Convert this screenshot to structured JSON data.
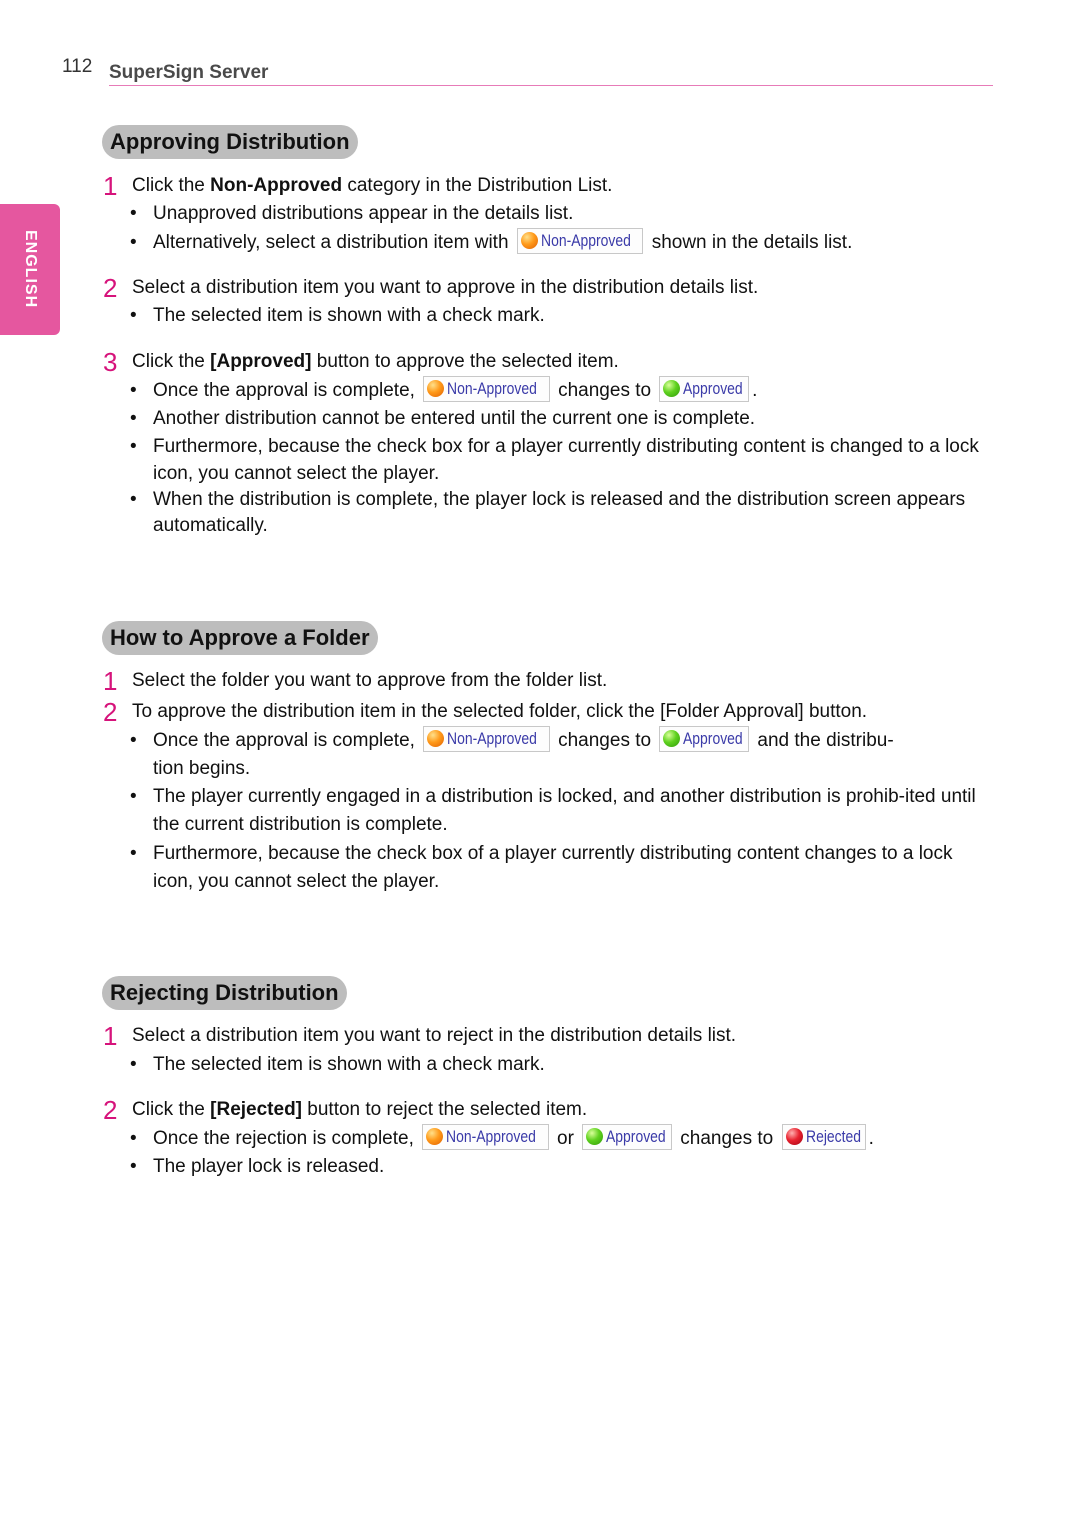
{
  "header": {
    "page_number": "112",
    "running_title": "SuperSign Server",
    "language_tab": "ENGLISH",
    "accent_color": "#e5579f"
  },
  "badges": {
    "non_approved": {
      "label": "Non-Approved",
      "icon": "orange-status-ball-icon",
      "color": "#ff8c00"
    },
    "approved": {
      "label": "Approved",
      "icon": "green-status-ball-icon",
      "color": "#4cc21a"
    },
    "rejected": {
      "label": "Rejected",
      "icon": "red-status-ball-icon",
      "color": "#d9142a"
    }
  },
  "sections": [
    {
      "title": "Approving Distribution",
      "steps": [
        {
          "num": "1",
          "text_pre": "Click the ",
          "bold": "Non-Approved",
          "text_post": " category in the Distribution List.",
          "bullets": [
            "Unapproved distributions appear in the details list.",
            {
              "pre": "Alternatively, select a distribution item with ",
              "post": " shown in the details list."
            }
          ]
        },
        {
          "num": "2",
          "text": "Select a distribution item you want to approve in the distribution details list.",
          "bullets": [
            "The selected item is shown with a check mark."
          ]
        },
        {
          "num": "3",
          "text_pre": "Click the ",
          "bold": "[Approved]",
          "text_post": " button to approve the selected item.",
          "bullets": [
            {
              "pre": "Once the approval is complete, ",
              "mid": " changes to ",
              "post": "."
            },
            "Another distribution cannot be entered until the current one is complete.",
            "Furthermore, because the check box for a player currently distributing content is changed to a lock icon, you cannot select the player.",
            "When the distribution is complete, the player lock is released and the distribution screen appears automatically."
          ]
        }
      ]
    },
    {
      "title": "How to Approve a Folder",
      "steps": [
        {
          "num": "1",
          "text": "Select the folder you want to approve from the folder list."
        },
        {
          "num": "2",
          "text": "To approve the distribution item in the selected folder, click the [Folder Approval] button.",
          "bullets": [
            {
              "pre": "Once the approval is complete, ",
              "mid": " changes to ",
              "post": " and the distribu-",
              "cont": "tion begins."
            },
            "The player currently engaged in a distribution is locked, and another distribution is prohib-ited until the current distribution is complete.",
            "Furthermore, because the check box of a player currently distributing content changes to a lock icon, you cannot select the player."
          ]
        }
      ]
    },
    {
      "title": "Rejecting Distribution",
      "steps": [
        {
          "num": "1",
          "text": "Select a distribution item you want to reject in the distribution details list.",
          "bullets": [
            "The selected item is shown with a check mark."
          ]
        },
        {
          "num": "2",
          "text_pre": "Click the ",
          "bold": "[Rejected]",
          "text_post": " button to reject the selected item.",
          "bullets": [
            {
              "pre": "Once the rejection is complete, ",
              "mid": " or ",
              "mid2": " changes to ",
              "post": "."
            },
            "The player lock is released."
          ]
        }
      ]
    }
  ],
  "bullet_char": "•"
}
